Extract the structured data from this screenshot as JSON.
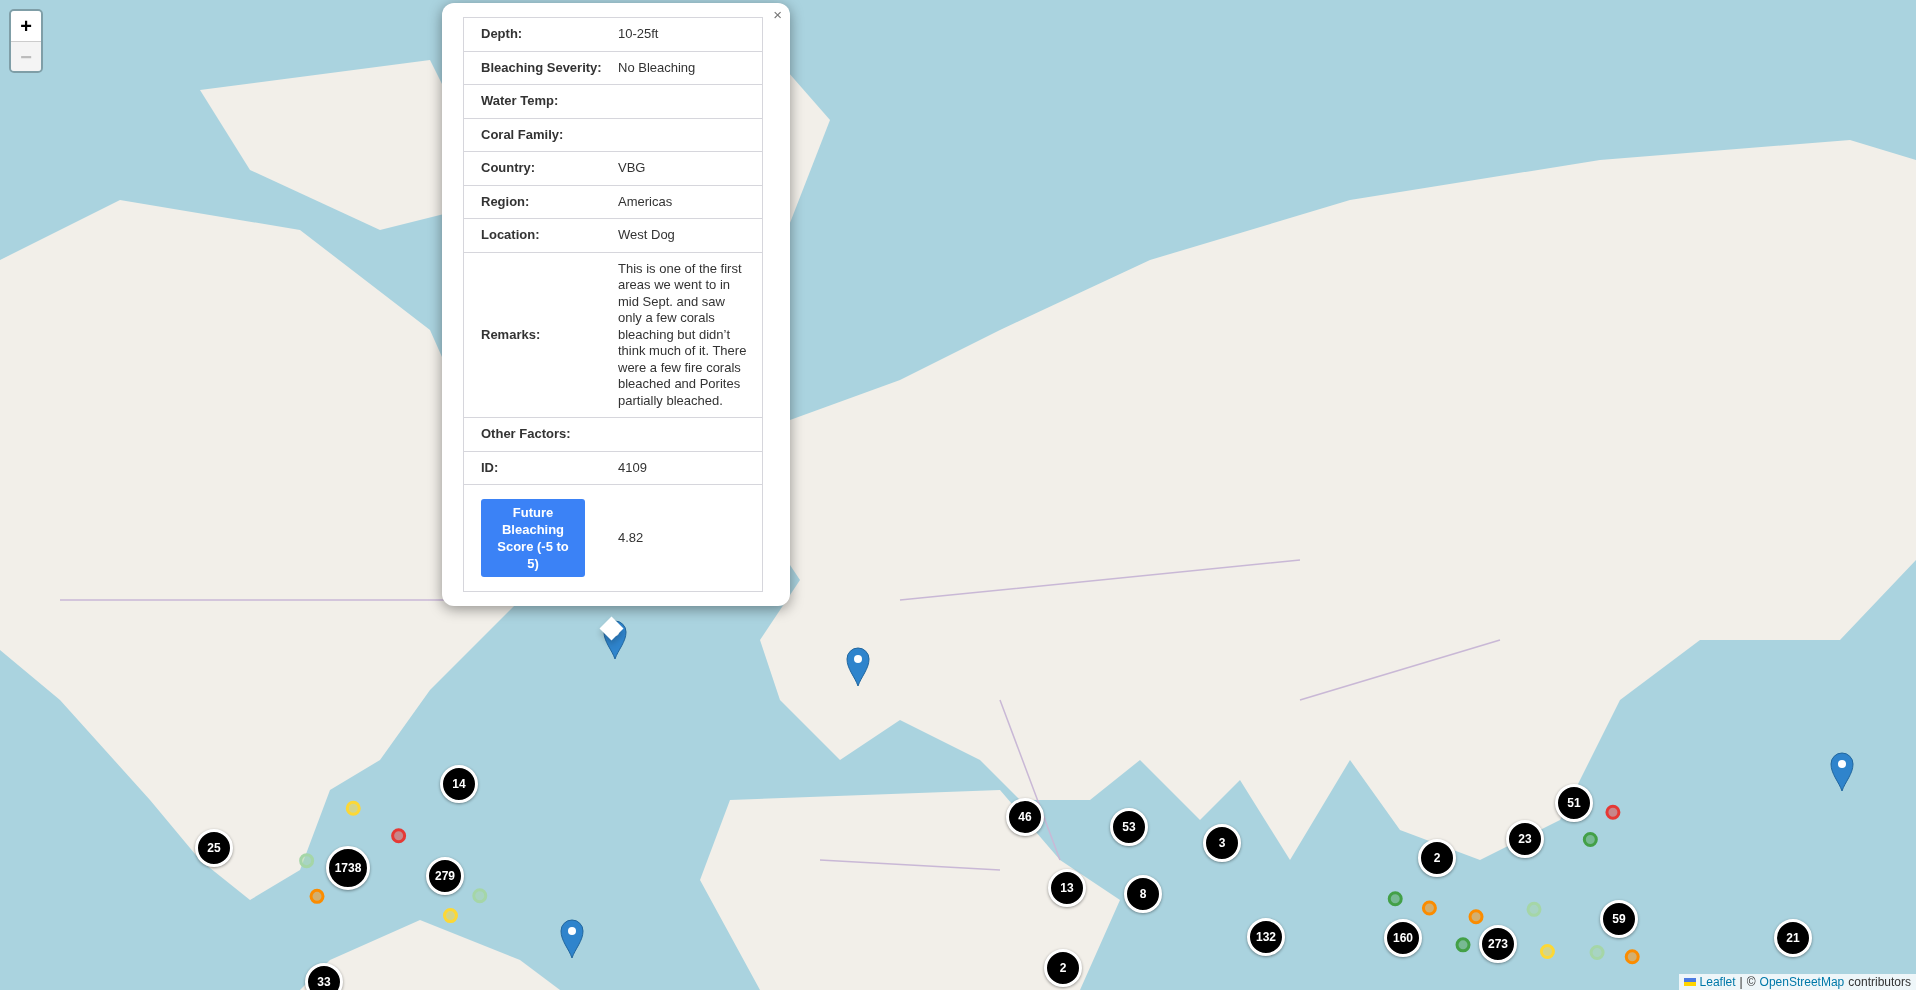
{
  "zoom_control": {
    "zoom_in": {
      "label": "+",
      "disabled": false
    },
    "zoom_out": {
      "label": "−",
      "disabled": true
    }
  },
  "popup": {
    "close": "×",
    "rows": [
      {
        "kind": "field",
        "label": "Depth:",
        "value": "10-25ft"
      },
      {
        "kind": "field",
        "label": "Bleaching Severity:",
        "value": "No Bleaching"
      },
      {
        "kind": "field",
        "label": "Water Temp:"
      },
      {
        "kind": "field",
        "label": "Coral Family:"
      },
      {
        "kind": "field",
        "label": "Country:",
        "value": "VBG"
      },
      {
        "kind": "field",
        "label": "Region:",
        "value": "Americas"
      },
      {
        "kind": "field",
        "label": "Location:",
        "value": "West Dog"
      },
      {
        "kind": "field",
        "label": "Remarks:",
        "value": "This is one of the first areas we went to in mid Sept. and saw only a few corals bleaching but didn’t think much of it. There were a few fire corals bleached and Porites partially bleached."
      },
      {
        "kind": "field",
        "label": "Other Factors:"
      },
      {
        "kind": "field",
        "label": "ID:",
        "value": "4109"
      },
      {
        "kind": "button",
        "label": "Future Bleaching Score (-5 to 5)",
        "value": "4.82"
      }
    ]
  },
  "clusters": [
    {
      "count": "14"
    },
    {
      "count": "25"
    },
    {
      "count": "1738"
    },
    {
      "count": "279"
    },
    {
      "count": "46"
    },
    {
      "count": "53"
    },
    {
      "count": "3"
    },
    {
      "count": "2"
    },
    {
      "count": "23"
    },
    {
      "count": "51"
    },
    {
      "count": "13"
    },
    {
      "count": "8"
    },
    {
      "count": "59"
    },
    {
      "count": "132"
    },
    {
      "count": "160"
    },
    {
      "count": "273"
    },
    {
      "count": "21"
    },
    {
      "count": "2"
    },
    {
      "count": "33"
    }
  ],
  "attribution": {
    "link": "Leaflet",
    "separator": "|",
    "copyright": "©",
    "source_link": "OpenStreetMap",
    "suffix": "contributors"
  }
}
